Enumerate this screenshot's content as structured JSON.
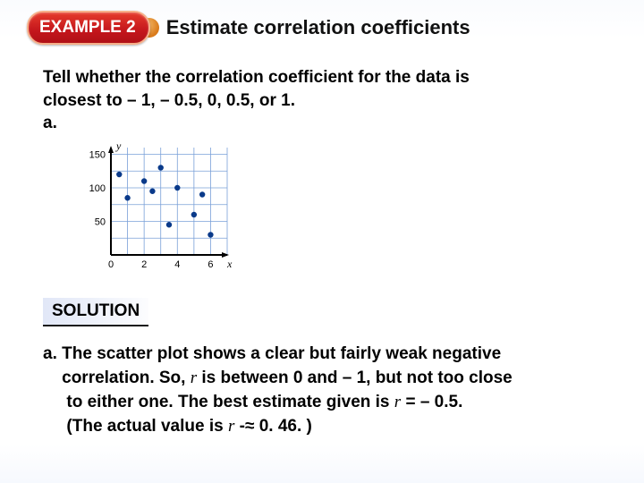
{
  "header": {
    "example_label": "EXAMPLE 2",
    "title": "Estimate correlation coefficients"
  },
  "prompt": {
    "line1": "Tell whether the correlation coefficient for the data is",
    "line2": "closest to – 1, – 0.5, 0, 0.5, or 1.",
    "part_label": "a."
  },
  "chart_data": {
    "type": "scatter",
    "title": "",
    "xlabel": "x",
    "ylabel": "y",
    "xlim": [
      0,
      7
    ],
    "ylim": [
      0,
      160
    ],
    "x_ticks": [
      0,
      2,
      4,
      6
    ],
    "y_ticks": [
      50,
      100,
      150
    ],
    "grid": true,
    "points": [
      {
        "x": 0.5,
        "y": 120
      },
      {
        "x": 1,
        "y": 85
      },
      {
        "x": 2,
        "y": 110
      },
      {
        "x": 2.5,
        "y": 95
      },
      {
        "x": 3,
        "y": 130
      },
      {
        "x": 3.5,
        "y": 45
      },
      {
        "x": 4,
        "y": 100
      },
      {
        "x": 5,
        "y": 60
      },
      {
        "x": 5.5,
        "y": 90
      },
      {
        "x": 6,
        "y": 30
      }
    ]
  },
  "solution": {
    "heading": "SOLUTION",
    "part_label": "a.",
    "line1_a": "The scatter plot shows a clear but fairly weak negative",
    "line2_a": "correlation. So, ",
    "line2_r": "r",
    "line2_b": " is between 0 and – 1, but not too close",
    "line3_a": "to either one. The best estimate given is ",
    "line3_r": "r",
    "line3_b": " = – 0.5.",
    "line4_a": "(The actual value is ",
    "line4_r": "r",
    "line4_b": " ‑≈  0. 46. )"
  }
}
